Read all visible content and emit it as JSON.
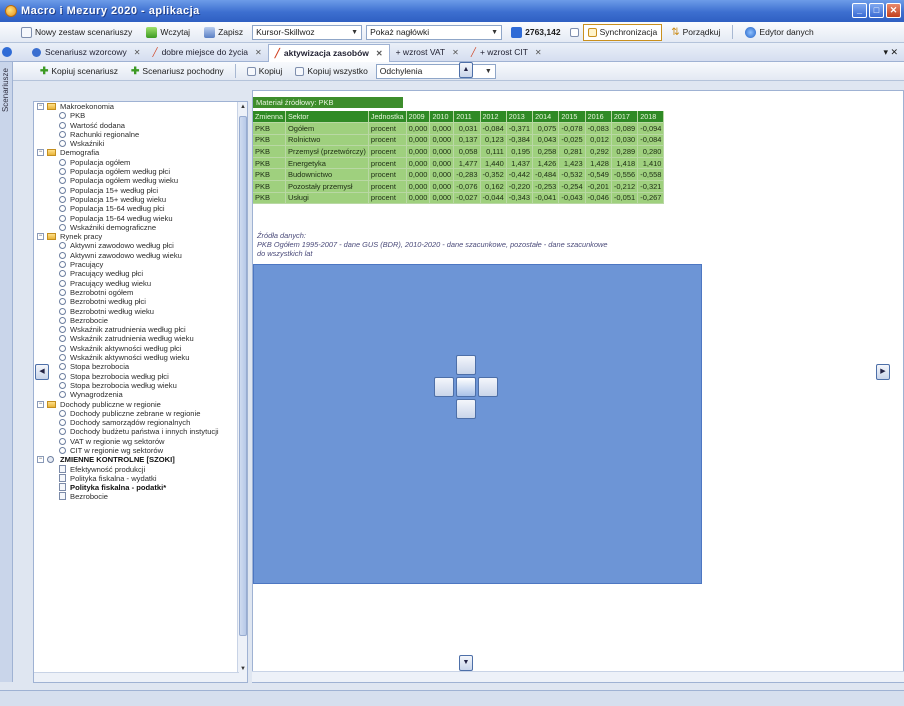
{
  "window": {
    "title": "Macro i Mezury 2020 - aplikacja"
  },
  "toolbar": {
    "new_label": "Nowy zestaw scenariuszy",
    "load_label": "Wczytaj",
    "save_label": "Zapisz",
    "scenario_select": "Kursor-Skillwoz",
    "headers_select": "Pokaż nagłówki",
    "value": "2763,142",
    "sync_label": "Synchronizacja",
    "sort_label": "Porządkuj",
    "editor_label": "Edytor danych"
  },
  "tabs": [
    {
      "label": "Scenariusz wzorcowy"
    },
    {
      "label": "dobre miejsce do życia"
    },
    {
      "label": "aktywizacja zasobów"
    },
    {
      "label": "+ wzrost VAT"
    },
    {
      "label": "+ wzrost CIT"
    }
  ],
  "side_panel": {
    "label": "Scenariusze"
  },
  "toolbar2": {
    "copy_scenario": "Kopiuj scenariusz",
    "derived_scenario": "Scenariusz pochodny",
    "copy": "Kopiuj",
    "copy_all": "Kopiuj wszystko",
    "display_label": "Odchylenia"
  },
  "tree": [
    {
      "level": 0,
      "kind": "folder",
      "label": "Makroekonomia"
    },
    {
      "level": 1,
      "kind": "item",
      "label": "PKB"
    },
    {
      "level": 1,
      "kind": "item",
      "label": "Wartość dodana"
    },
    {
      "level": 1,
      "kind": "item",
      "label": "Rachunki regionalne"
    },
    {
      "level": 1,
      "kind": "item",
      "label": "Wskaźniki"
    },
    {
      "level": 0,
      "kind": "folder",
      "label": "Demografia"
    },
    {
      "level": 1,
      "kind": "item",
      "label": "Populacja ogółem"
    },
    {
      "level": 1,
      "kind": "item",
      "label": "Populacja ogółem według płci"
    },
    {
      "level": 1,
      "kind": "item",
      "label": "Populacja ogółem według wieku"
    },
    {
      "level": 1,
      "kind": "item",
      "label": "Populacja 15+ według płci"
    },
    {
      "level": 1,
      "kind": "item",
      "label": "Populacja 15+ według wieku"
    },
    {
      "level": 1,
      "kind": "item",
      "label": "Populacja 15-64 według płci"
    },
    {
      "level": 1,
      "kind": "item",
      "label": "Populacja 15-64 według wieku"
    },
    {
      "level": 1,
      "kind": "item",
      "label": "Wskaźniki demograficzne"
    },
    {
      "level": 0,
      "kind": "folder",
      "label": "Rynek pracy"
    },
    {
      "level": 1,
      "kind": "item",
      "label": "Aktywni zawodowo według płci"
    },
    {
      "level": 1,
      "kind": "item",
      "label": "Aktywni zawodowo według wieku"
    },
    {
      "level": 1,
      "kind": "item",
      "label": "Pracujący"
    },
    {
      "level": 1,
      "kind": "item",
      "label": "Pracujący według płci"
    },
    {
      "level": 1,
      "kind": "item",
      "label": "Pracujący według wieku"
    },
    {
      "level": 1,
      "kind": "item",
      "label": "Bezrobotni ogółem"
    },
    {
      "level": 1,
      "kind": "item",
      "label": "Bezrobotni według płci"
    },
    {
      "level": 1,
      "kind": "item",
      "label": "Bezrobotni według wieku"
    },
    {
      "level": 1,
      "kind": "item",
      "label": "Bezrobocie"
    },
    {
      "level": 1,
      "kind": "item",
      "label": "Wskaźnik zatrudnienia według płci"
    },
    {
      "level": 1,
      "kind": "item",
      "label": "Wskaźnik zatrudnienia według wieku"
    },
    {
      "level": 1,
      "kind": "item",
      "label": "Wskaźnik aktywności według płci"
    },
    {
      "level": 1,
      "kind": "item",
      "label": "Wskaźnik aktywności według wieku"
    },
    {
      "level": 1,
      "kind": "item",
      "label": "Stopa bezrobocia"
    },
    {
      "level": 1,
      "kind": "item",
      "label": "Stopa bezrobocia według płci"
    },
    {
      "level": 1,
      "kind": "item",
      "label": "Stopa bezrobocia według wieku"
    },
    {
      "level": 1,
      "kind": "item",
      "label": "Wynagrodzenia"
    },
    {
      "level": 0,
      "kind": "folder",
      "label": "Dochody publiczne w regionie"
    },
    {
      "level": 1,
      "kind": "item",
      "label": "Dochody publiczne zebrane w regionie"
    },
    {
      "level": 1,
      "kind": "item",
      "label": "Dochody samorządów regionalnych"
    },
    {
      "level": 1,
      "kind": "item",
      "label": "Dochody budżetu państwa i innych instytucji"
    },
    {
      "level": 1,
      "kind": "item",
      "label": "VAT w regionie wg sektorów"
    },
    {
      "level": 1,
      "kind": "item",
      "label": "CIT w regionie wg sektorów"
    },
    {
      "level": 0,
      "kind": "control",
      "label": "ZMIENNE KONTROLNE [SZOKI]",
      "bold": true
    },
    {
      "level": 1,
      "kind": "doc",
      "label": "Efektywność produkcji"
    },
    {
      "level": 1,
      "kind": "doc",
      "label": "Polityka fiskalna - wydatki"
    },
    {
      "level": 1,
      "kind": "doc",
      "label": "Polityka fiskalna - podatki*",
      "bold": true
    },
    {
      "level": 1,
      "kind": "doc",
      "label": "Bezrobocie"
    }
  ],
  "data_panel": {
    "title": "Materiał źródłowy: PKB",
    "columns": [
      "Zmienna",
      "Sektor",
      "Jednostka",
      "2009",
      "2010",
      "2011",
      "2012",
      "2013",
      "2014",
      "2015",
      "2016",
      "2017",
      "2018"
    ],
    "rows": [
      [
        "PKB",
        "Ogółem",
        "procent",
        "0,000",
        "0,000",
        "0,031",
        "-0,084",
        "-0,371",
        "0,075",
        "-0,078",
        "-0,083",
        "-0,089",
        "-0,094"
      ],
      [
        "PKB",
        "Rolnictwo",
        "procent",
        "0,000",
        "0,000",
        "0,137",
        "0,123",
        "-0,384",
        "0,043",
        "-0,025",
        "0,012",
        "0,030",
        "-0,084"
      ],
      [
        "PKB",
        "Przemysł (przetwórczy)",
        "procent",
        "0,000",
        "0,000",
        "0,058",
        "0,111",
        "0,195",
        "0,258",
        "0,281",
        "0,292",
        "0,289",
        "0,280"
      ],
      [
        "PKB",
        "Energetyka",
        "procent",
        "0,000",
        "0,000",
        "1,477",
        "1,440",
        "1,437",
        "1,426",
        "1,423",
        "1,428",
        "1,418",
        "1,410"
      ],
      [
        "PKB",
        "Budownictwo",
        "procent",
        "0,000",
        "0,000",
        "-0,283",
        "-0,352",
        "-0,442",
        "-0,484",
        "-0,532",
        "-0,549",
        "-0,556",
        "-0,558"
      ],
      [
        "PKB",
        "Pozostały przemysł",
        "procent",
        "0,000",
        "0,000",
        "-0,076",
        "0,162",
        "-0,220",
        "-0,253",
        "-0,254",
        "-0,201",
        "-0,212",
        "-0,321"
      ],
      [
        "PKB",
        "Usługi",
        "procent",
        "0,000",
        "0,000",
        "-0,027",
        "-0,044",
        "-0,343",
        "-0,041",
        "-0,043",
        "-0,046",
        "-0,051",
        "-0,267"
      ]
    ],
    "notes_heading": "Źródła danych:",
    "notes_text": "PKB Ogółem 1995-2007 - dane GUS (BDR), 2010-2020 - dane szacunkowe, pozostałe - dane szacunkowe",
    "notes_text2": "do wszystkich lat"
  },
  "colors": {
    "titlebar": "#3d6fd0",
    "table_header": "#2f8a25",
    "table_row": "#9fd07e",
    "dock_overlay": "#6d95d6"
  }
}
